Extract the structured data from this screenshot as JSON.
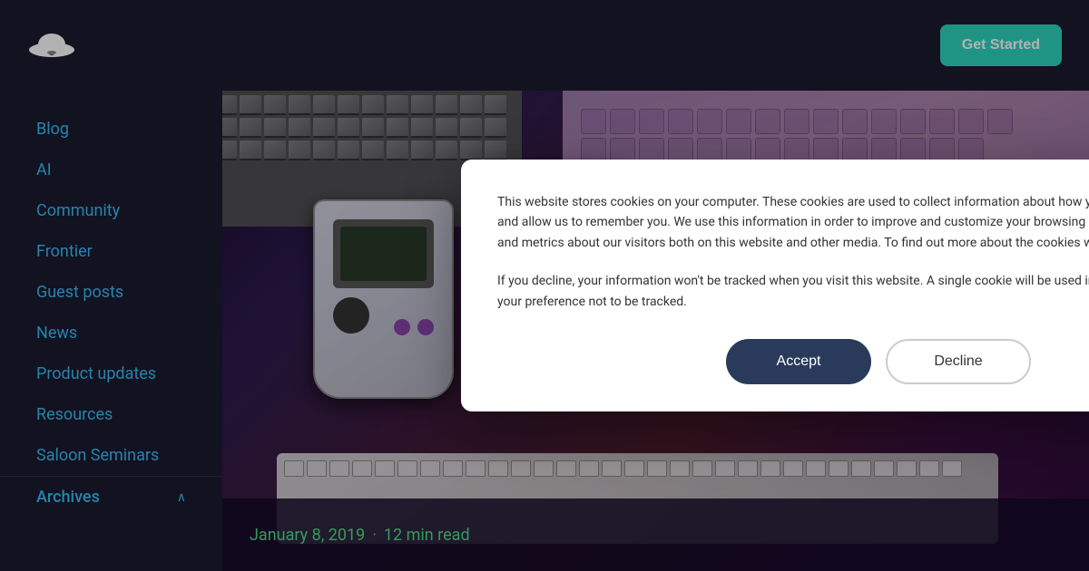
{
  "header": {
    "get_started_label": "Get Started"
  },
  "sidebar": {
    "items": [
      {
        "label": "Blog",
        "id": "blog"
      },
      {
        "label": "AI",
        "id": "ai"
      },
      {
        "label": "Community",
        "id": "community"
      },
      {
        "label": "Frontier",
        "id": "frontier"
      },
      {
        "label": "Guest posts",
        "id": "guest-posts"
      },
      {
        "label": "News",
        "id": "news"
      },
      {
        "label": "Product updates",
        "id": "product-updates"
      },
      {
        "label": "Resources",
        "id": "resources"
      },
      {
        "label": "Saloon Seminars",
        "id": "saloon-seminars"
      }
    ],
    "archives_label": "Archives",
    "archives_chevron": "∧"
  },
  "article": {
    "date": "January 8, 2019",
    "separator": "·",
    "read_time": "12 min read"
  },
  "cookie": {
    "text1": "This website stores cookies on your computer. These cookies are used to collect information about how you interact with our website and allow us to remember you. We use this information in order to improve and customize your browsing experience and for analytics and metrics about our visitors both on this website and other media. To find out more about the cookies we use, see our Privacy Policy.",
    "text2": "If you decline, your information won't be tracked when you visit this website. A single cookie will be used in your browser to remember your preference not to be tracked.",
    "accept_label": "Accept",
    "decline_label": "Decline"
  },
  "logo": {
    "alt": "Cowboy hat logo"
  }
}
